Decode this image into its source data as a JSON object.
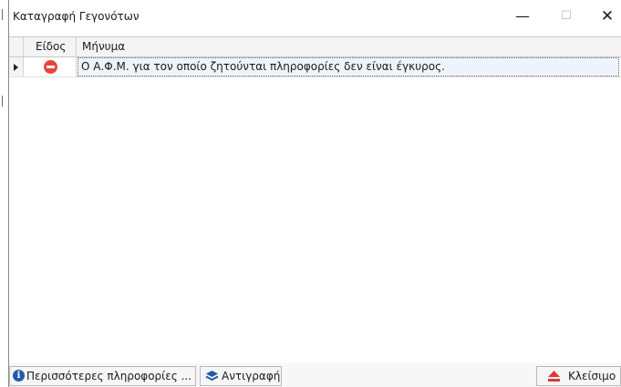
{
  "window": {
    "title": "Καταγραφή Γεγονότων",
    "minimize_glyph": "—",
    "maximize_glyph": "☐",
    "close_glyph": "✕"
  },
  "grid": {
    "columns": [
      "Είδος",
      "Μήνυμα"
    ],
    "rows": [
      {
        "type_icon": "stop-icon",
        "type_color": "#e9443c",
        "message": "Ο Α.Φ.Μ. για τον οποίο ζητούνται πληροφορίες δεν είναι έγκυρος.",
        "selected": true
      }
    ]
  },
  "buttons": {
    "more_info": {
      "label": "Περισσότερες πληροφορίες ...",
      "icon": "info-icon"
    },
    "copy": {
      "label": "Αντιγραφή",
      "icon": "layers-icon"
    },
    "close": {
      "label": "Κλείσιμο",
      "icon": "eject-icon"
    }
  },
  "colors": {
    "accent": "#1f5ca8",
    "error": "#e9443c",
    "selection": "#eef4fb"
  }
}
